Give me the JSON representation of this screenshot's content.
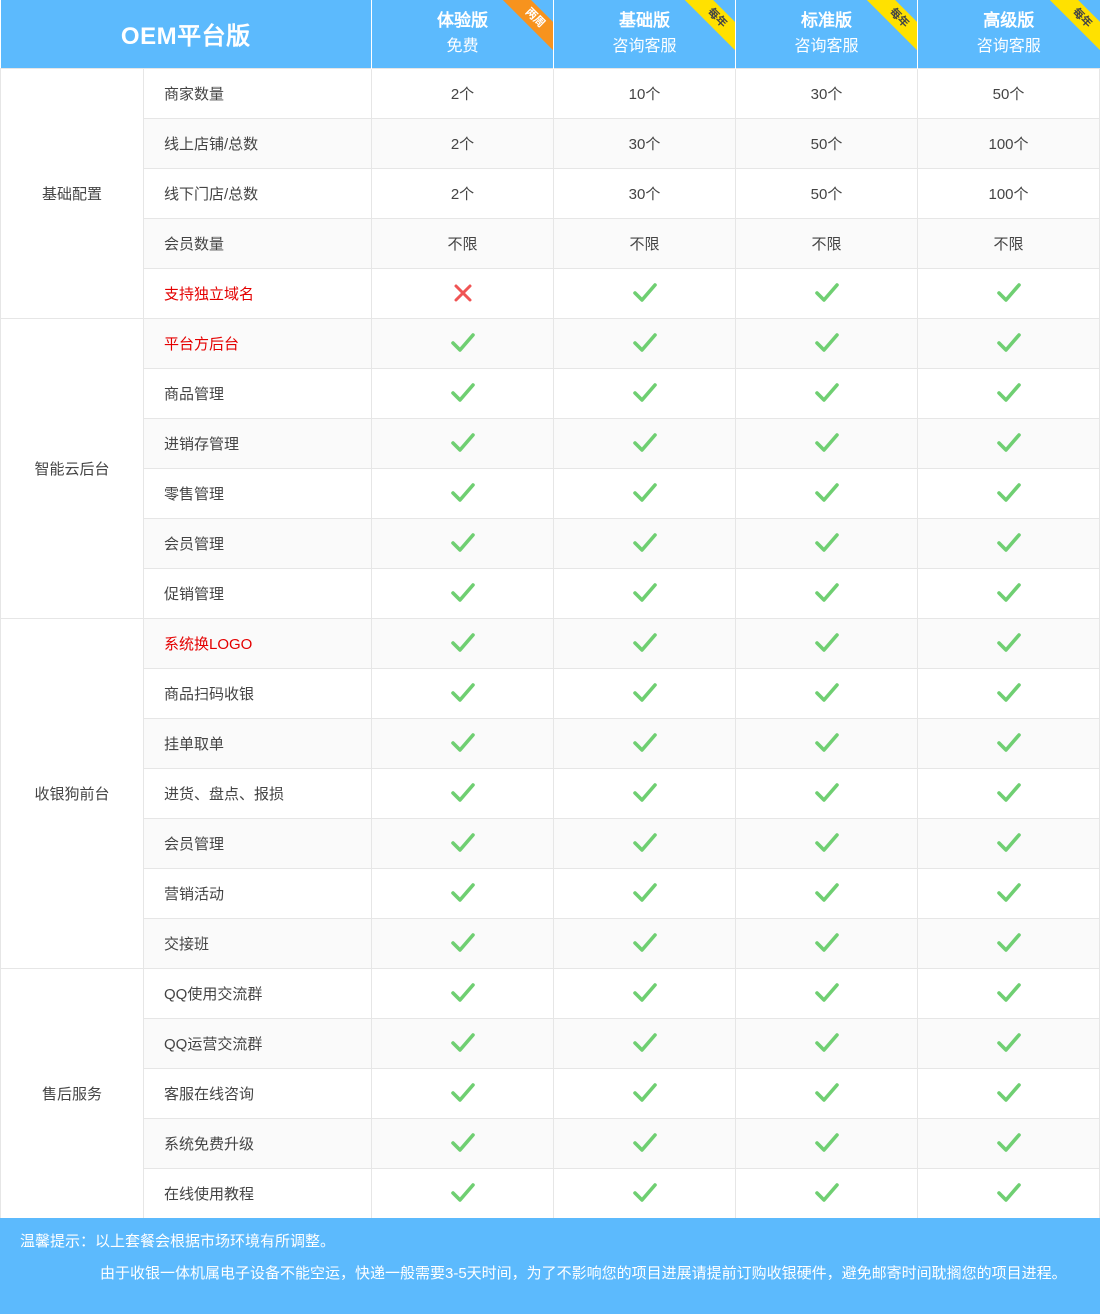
{
  "header": {
    "brand": "OEM平台版",
    "plans": [
      {
        "name": "体验版",
        "price": "免费",
        "badge": "两周",
        "badge_color": "#f7931e"
      },
      {
        "name": "基础版",
        "price": "咨询客服",
        "badge": "每年",
        "badge_color": "#ffe100"
      },
      {
        "name": "标准版",
        "price": "咨询客服",
        "badge": "每年",
        "badge_color": "#ffe100"
      },
      {
        "name": "高级版",
        "price": "咨询客服",
        "badge": "每年",
        "badge_color": "#ffe100"
      }
    ]
  },
  "colors": {
    "header_bg": "#5cbafd",
    "check": "#6fcf72",
    "cross": "#f05454",
    "highlight_text": "#e40000"
  },
  "sections": [
    {
      "category": "基础配置",
      "rows": [
        {
          "feature": "商家数量",
          "highlight": false,
          "values": [
            "2个",
            "10个",
            "30个",
            "50个"
          ]
        },
        {
          "feature": "线上店铺/总数",
          "highlight": false,
          "values": [
            "2个",
            "30个",
            "50个",
            "100个"
          ]
        },
        {
          "feature": "线下门店/总数",
          "highlight": false,
          "values": [
            "2个",
            "30个",
            "50个",
            "100个"
          ]
        },
        {
          "feature": "会员数量",
          "highlight": false,
          "values": [
            "不限",
            "不限",
            "不限",
            "不限"
          ]
        },
        {
          "feature": "支持独立域名",
          "highlight": true,
          "values": [
            "cross-icon",
            "check-icon",
            "check-icon",
            "check-icon"
          ]
        }
      ]
    },
    {
      "category": "智能云后台",
      "rows": [
        {
          "feature": "平台方后台",
          "highlight": true,
          "values": [
            "check-icon",
            "check-icon",
            "check-icon",
            "check-icon"
          ]
        },
        {
          "feature": "商品管理",
          "highlight": false,
          "values": [
            "check-icon",
            "check-icon",
            "check-icon",
            "check-icon"
          ]
        },
        {
          "feature": "进销存管理",
          "highlight": false,
          "values": [
            "check-icon",
            "check-icon",
            "check-icon",
            "check-icon"
          ]
        },
        {
          "feature": "零售管理",
          "highlight": false,
          "values": [
            "check-icon",
            "check-icon",
            "check-icon",
            "check-icon"
          ]
        },
        {
          "feature": "会员管理",
          "highlight": false,
          "values": [
            "check-icon",
            "check-icon",
            "check-icon",
            "check-icon"
          ]
        },
        {
          "feature": "促销管理",
          "highlight": false,
          "values": [
            "check-icon",
            "check-icon",
            "check-icon",
            "check-icon"
          ]
        }
      ]
    },
    {
      "category": "收银狗前台",
      "rows": [
        {
          "feature": "系统换LOGO",
          "highlight": true,
          "values": [
            "check-icon",
            "check-icon",
            "check-icon",
            "check-icon"
          ]
        },
        {
          "feature": "商品扫码收银",
          "highlight": false,
          "values": [
            "check-icon",
            "check-icon",
            "check-icon",
            "check-icon"
          ]
        },
        {
          "feature": "挂单取单",
          "highlight": false,
          "values": [
            "check-icon",
            "check-icon",
            "check-icon",
            "check-icon"
          ]
        },
        {
          "feature": "进货、盘点、报损",
          "highlight": false,
          "values": [
            "check-icon",
            "check-icon",
            "check-icon",
            "check-icon"
          ]
        },
        {
          "feature": "会员管理",
          "highlight": false,
          "values": [
            "check-icon",
            "check-icon",
            "check-icon",
            "check-icon"
          ]
        },
        {
          "feature": "营销活动",
          "highlight": false,
          "values": [
            "check-icon",
            "check-icon",
            "check-icon",
            "check-icon"
          ]
        },
        {
          "feature": "交接班",
          "highlight": false,
          "values": [
            "check-icon",
            "check-icon",
            "check-icon",
            "check-icon"
          ]
        }
      ]
    },
    {
      "category": "售后服务",
      "rows": [
        {
          "feature": "QQ使用交流群",
          "highlight": false,
          "values": [
            "check-icon",
            "check-icon",
            "check-icon",
            "check-icon"
          ]
        },
        {
          "feature": "QQ运营交流群",
          "highlight": false,
          "values": [
            "check-icon",
            "check-icon",
            "check-icon",
            "check-icon"
          ]
        },
        {
          "feature": "客服在线咨询",
          "highlight": false,
          "values": [
            "check-icon",
            "check-icon",
            "check-icon",
            "check-icon"
          ]
        },
        {
          "feature": "系统免费升级",
          "highlight": false,
          "values": [
            "check-icon",
            "check-icon",
            "check-icon",
            "check-icon"
          ]
        },
        {
          "feature": "在线使用教程",
          "highlight": false,
          "values": [
            "check-icon",
            "check-icon",
            "check-icon",
            "check-icon"
          ]
        }
      ]
    }
  ],
  "footer": {
    "tip_label": "温馨提示：",
    "tip_text": "以上套餐会根据市场环境有所调整。",
    "note": "由于收银一体机属电子设备不能空运，快递一般需要3-5天时间，为了不影响您的项目进展请提前订购收银硬件，避免邮寄时间耽搁您的项目进程。"
  }
}
